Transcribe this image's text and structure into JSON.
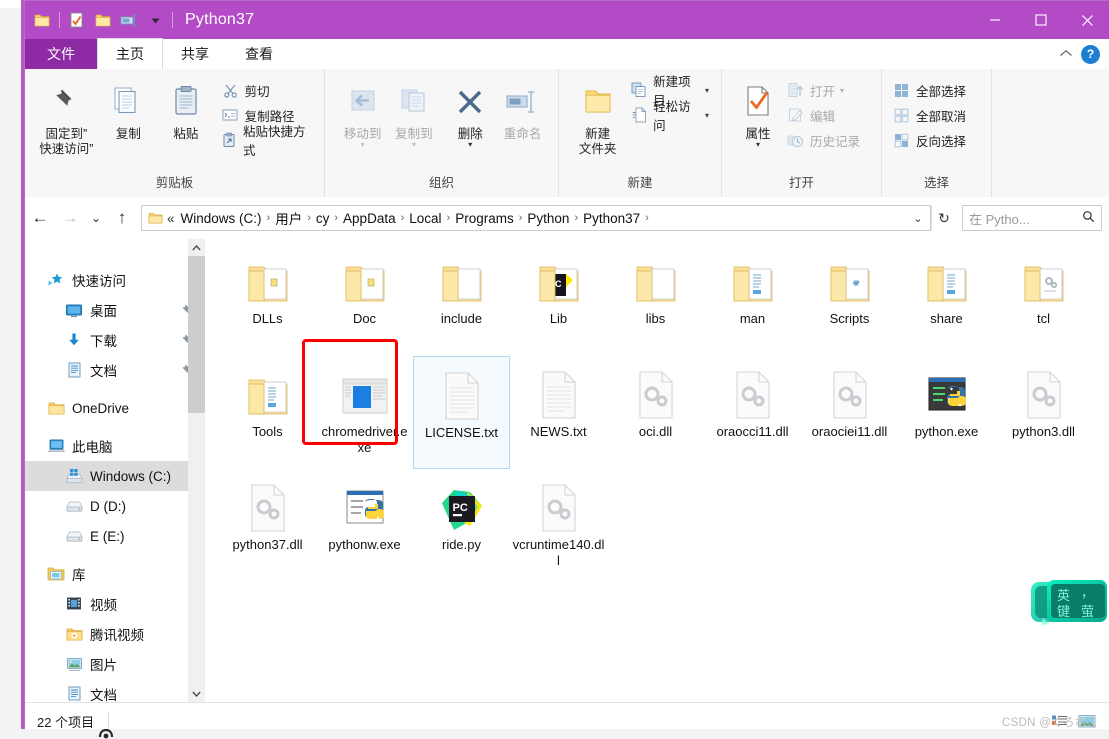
{
  "window": {
    "title": "Python37",
    "quick_access_icons": [
      "folder-icon",
      "properties-check-icon",
      "folder-new-icon",
      "rename-icon",
      "customize-caret-icon"
    ],
    "controls": {
      "minimize": "minimize-icon",
      "maximize": "maximize-icon",
      "close": "close-icon"
    }
  },
  "tabs": [
    {
      "id": "file",
      "label": "文件"
    },
    {
      "id": "home",
      "label": "主页"
    },
    {
      "id": "share",
      "label": "共享"
    },
    {
      "id": "view",
      "label": "查看"
    }
  ],
  "tab_right": {
    "collapse": "⌃",
    "help": "?"
  },
  "ribbon": {
    "groups": [
      {
        "name": "clipboard",
        "label": "剪贴板",
        "big": [
          {
            "name": "pin-to-quick-access",
            "label": "固定到“\n快速访问”",
            "line1": "固定到”",
            "line2": "快速访问”",
            "icon": "pin-icon"
          },
          {
            "name": "copy",
            "label": "复制",
            "icon": "copy-icon"
          },
          {
            "name": "paste",
            "label": "粘贴",
            "icon": "paste-icon"
          }
        ],
        "small": [
          {
            "name": "cut",
            "label": "剪切",
            "icon": "scissors-icon",
            "disabled": false
          },
          {
            "name": "copy-path",
            "label": "复制路径",
            "icon": "copy-path-icon",
            "disabled": false
          },
          {
            "name": "paste-shortcut",
            "label": "粘贴快捷方式",
            "icon": "paste-shortcut-icon",
            "disabled": false
          }
        ]
      },
      {
        "name": "organize",
        "label": "组织",
        "big": [
          {
            "name": "move-to",
            "label": "移动到",
            "icon": "move-to-icon",
            "disabled": true,
            "caret": true
          },
          {
            "name": "copy-to",
            "label": "复制到",
            "icon": "copy-to-icon",
            "disabled": true,
            "caret": true
          },
          {
            "name": "delete",
            "label": "删除",
            "icon": "delete-x-icon",
            "disabled": false,
            "caret": true
          },
          {
            "name": "rename",
            "label": "重命名",
            "icon": "rename-icon",
            "disabled": true,
            "caret": false
          }
        ]
      },
      {
        "name": "new",
        "label": "新建",
        "big": [
          {
            "name": "new-folder",
            "line1": "新建",
            "line2": "文件夹",
            "label": "新建文件夹",
            "icon": "new-folder-icon"
          }
        ],
        "small": [
          {
            "name": "new-item",
            "label": "新建项目",
            "icon": "new-item-icon",
            "caret": true
          },
          {
            "name": "easy-access",
            "label": "轻松访问",
            "icon": "easy-access-icon",
            "caret": true
          }
        ]
      },
      {
        "name": "open",
        "label": "打开",
        "big": [
          {
            "name": "properties",
            "label": "属性",
            "icon": "properties-icon",
            "caret": true
          }
        ],
        "small": [
          {
            "name": "open",
            "label": "打开",
            "icon": "open-icon",
            "disabled": true,
            "caret": true
          },
          {
            "name": "edit",
            "label": "编辑",
            "icon": "edit-icon",
            "disabled": true
          },
          {
            "name": "history",
            "label": "历史记录",
            "icon": "history-icon",
            "disabled": true
          }
        ]
      },
      {
        "name": "select",
        "label": "选择",
        "small": [
          {
            "name": "select-all",
            "label": "全部选择",
            "icon": "select-all-icon"
          },
          {
            "name": "select-none",
            "label": "全部取消",
            "icon": "select-none-icon"
          },
          {
            "name": "invert-selection",
            "label": "反向选择",
            "icon": "invert-selection-icon"
          }
        ]
      }
    ]
  },
  "address": {
    "back": "←",
    "forward": "→",
    "recent": "⌄",
    "up": "↑",
    "lead": "«",
    "crumbs": [
      "Windows (C:)",
      "用户",
      "cy",
      "AppData",
      "Local",
      "Programs",
      "Python",
      "Python37"
    ],
    "trailing_sep": "›",
    "dropdown": "⌄",
    "refresh": "↻",
    "search_placeholder": "在 Pytho...",
    "search_value": "",
    "search_icon": "magnifier-icon"
  },
  "nav_pane": {
    "items": [
      {
        "name": "quick-access",
        "label": "快速访问",
        "icon": "quick-access-star-icon",
        "level": 0,
        "pin": false,
        "state": ""
      },
      {
        "name": "desktop",
        "label": "桌面",
        "icon": "desktop-icon",
        "level": 1,
        "pin": true,
        "state": ""
      },
      {
        "name": "downloads",
        "label": "下载",
        "icon": "downloads-icon",
        "level": 1,
        "pin": true,
        "state": ""
      },
      {
        "name": "documents",
        "label": "文档",
        "icon": "documents-icon",
        "level": 1,
        "pin": true,
        "state": ""
      },
      {
        "name": "onedrive",
        "label": "OneDrive",
        "icon": "onedrive-folder-icon",
        "level": 0,
        "pin": false,
        "state": ""
      },
      {
        "name": "this-pc",
        "label": "此电脑",
        "icon": "this-pc-icon",
        "level": 0,
        "pin": false,
        "state": ""
      },
      {
        "name": "windows-c",
        "label": "Windows (C:)",
        "icon": "drive-windows-icon",
        "level": 1,
        "pin": false,
        "state": "selgray"
      },
      {
        "name": "drive-d",
        "label": "D (D:)",
        "icon": "drive-icon",
        "level": 1,
        "pin": false,
        "state": ""
      },
      {
        "name": "drive-e",
        "label": "E (E:)",
        "icon": "drive-icon",
        "level": 1,
        "pin": false,
        "state": ""
      },
      {
        "name": "libraries",
        "label": "库",
        "icon": "library-icon",
        "level": 0,
        "pin": false,
        "state": ""
      },
      {
        "name": "videos",
        "label": "视频",
        "icon": "videos-icon",
        "level": 1,
        "pin": false,
        "state": ""
      },
      {
        "name": "tencent-video",
        "label": "腾讯视频",
        "icon": "tencent-video-icon",
        "level": 1,
        "pin": false,
        "state": ""
      },
      {
        "name": "pictures",
        "label": "图片",
        "icon": "pictures-icon",
        "level": 1,
        "pin": false,
        "state": ""
      },
      {
        "name": "documents-lib",
        "label": "文档",
        "icon": "documents-icon",
        "level": 1,
        "pin": false,
        "state": ""
      }
    ],
    "scrollbar": {
      "up": "⌃",
      "down": "⌄"
    }
  },
  "files": [
    {
      "name": "DLLs",
      "icon": "folder-python-icon",
      "kind": "folder",
      "state": ""
    },
    {
      "name": "Doc",
      "icon": "folder-python-icon",
      "kind": "folder",
      "state": ""
    },
    {
      "name": "include",
      "icon": "folder-empty-icon",
      "kind": "folder",
      "state": ""
    },
    {
      "name": "Lib",
      "icon": "folder-pycharm-icon",
      "kind": "folder",
      "state": ""
    },
    {
      "name": "libs",
      "icon": "folder-empty-icon",
      "kind": "folder",
      "state": ""
    },
    {
      "name": "man",
      "icon": "folder-docs-icon",
      "kind": "folder",
      "state": ""
    },
    {
      "name": "Scripts",
      "icon": "folder-apps-icon",
      "kind": "folder",
      "state": ""
    },
    {
      "name": "share",
      "icon": "folder-docs-icon",
      "kind": "folder",
      "state": ""
    },
    {
      "name": "tcl",
      "icon": "folder-gears-icon",
      "kind": "folder",
      "state": ""
    },
    {
      "name": "Tools",
      "icon": "folder-docs-icon",
      "kind": "folder",
      "state": ""
    },
    {
      "name": "chromedriver.exe",
      "icon": "chromedriver-icon",
      "kind": "exe",
      "state": "marked"
    },
    {
      "name": "LICENSE.txt",
      "icon": "text-file-icon",
      "kind": "txt",
      "state": "hover"
    },
    {
      "name": "NEWS.txt",
      "icon": "text-file-icon",
      "kind": "txt",
      "state": ""
    },
    {
      "name": "oci.dll",
      "icon": "dll-file-icon",
      "kind": "dll",
      "state": ""
    },
    {
      "name": "oraocci11.dll",
      "icon": "dll-file-icon",
      "kind": "dll",
      "state": ""
    },
    {
      "name": "oraociei11.dll",
      "icon": "dll-file-icon",
      "kind": "dll",
      "state": ""
    },
    {
      "name": "python.exe",
      "icon": "python-console-icon",
      "kind": "exe",
      "state": ""
    },
    {
      "name": "python3.dll",
      "icon": "dll-file-icon",
      "kind": "dll",
      "state": ""
    },
    {
      "name": "python37.dll",
      "icon": "dll-file-icon",
      "kind": "dll",
      "state": ""
    },
    {
      "name": "pythonw.exe",
      "icon": "pythonw-icon",
      "kind": "exe",
      "state": ""
    },
    {
      "name": "ride.py",
      "icon": "pycharm-icon",
      "kind": "py",
      "state": ""
    },
    {
      "name": "vcruntime140.dll",
      "icon": "dll-file-icon",
      "kind": "dll",
      "state": ""
    }
  ],
  "status": {
    "item_count": "22 个项目",
    "view_icons": [
      "details-view-icon",
      "large-icons-view-icon"
    ]
  },
  "overlays": {
    "ime_widget": {
      "name": "ime-toolbar",
      "line1": "英",
      "line2": "键",
      "line3": "，",
      "line4": "萤"
    },
    "watermark": "CSDN @くろねこ"
  },
  "colors": {
    "titlebar": "#b34bc6",
    "file_tab": "#8e2aa3",
    "ribbon_bg": "#f7f7f8",
    "highlight_red": "#fb0000",
    "hover_blue": "#b6d8ef",
    "selection_gray": "#dcdcdc",
    "folder_yellow": "#ffe08a",
    "accent_blue": "#1d7fd1"
  }
}
